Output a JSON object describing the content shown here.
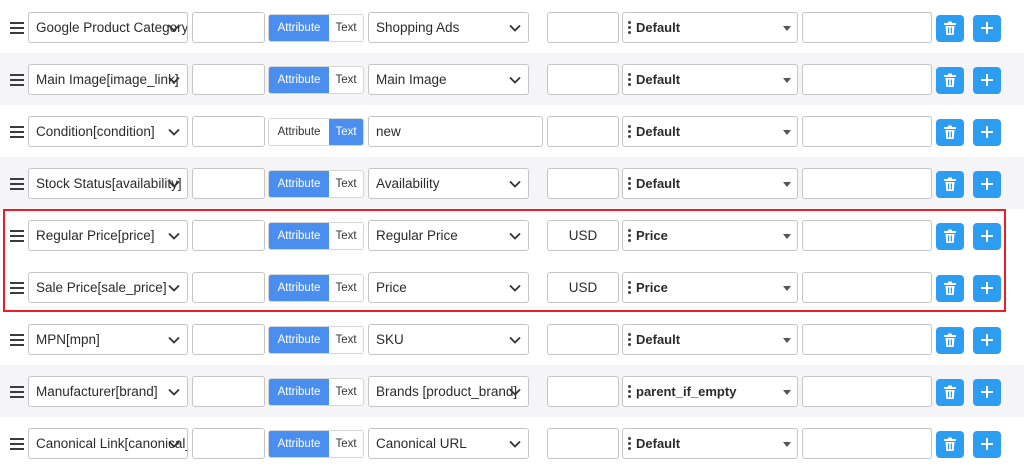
{
  "toggle": {
    "attribute_label": "Attribute",
    "text_label": "Text"
  },
  "colors": {
    "accent": "#4a8ef0",
    "button": "#2d9df2",
    "highlight": "#ee1c25",
    "row_alt": "#f5f5f7"
  },
  "rows": [
    {
      "field": "Google Product Category[google_product_category]",
      "mode": "attribute",
      "value": "Shopping Ads",
      "suffix": "",
      "output_type": "Default"
    },
    {
      "field": "Main Image[image_link]",
      "mode": "attribute",
      "value": "Main Image",
      "suffix": "",
      "output_type": "Default"
    },
    {
      "field": "Condition[condition]",
      "mode": "text",
      "value": "new",
      "suffix": "",
      "output_type": "Default"
    },
    {
      "field": "Stock Status[availability]",
      "mode": "attribute",
      "value": "Availability",
      "suffix": "",
      "output_type": "Default"
    },
    {
      "field": "Regular Price[price]",
      "mode": "attribute",
      "value": "Regular Price",
      "suffix": "USD",
      "output_type": "Price"
    },
    {
      "field": "Sale Price[sale_price]",
      "mode": "attribute",
      "value": "Price",
      "suffix": "USD",
      "output_type": "Price"
    },
    {
      "field": "MPN[mpn]",
      "mode": "attribute",
      "value": "SKU",
      "suffix": "",
      "output_type": "Default"
    },
    {
      "field": "Manufacturer[brand]",
      "mode": "attribute",
      "value": "Brands [product_brand]",
      "suffix": "",
      "output_type": "parent_if_empty"
    },
    {
      "field": "Canonical Link[canonical_link]",
      "mode": "attribute",
      "value": "Canonical URL",
      "suffix": "",
      "output_type": "Default"
    }
  ]
}
